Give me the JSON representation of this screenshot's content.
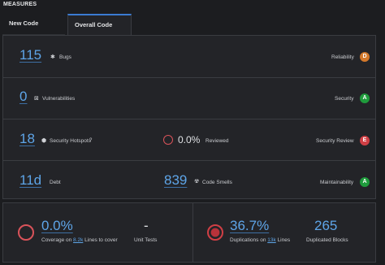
{
  "header": {
    "title": "MEASURES"
  },
  "tabs": [
    {
      "label": "New Code"
    },
    {
      "label": "Overall Code"
    }
  ],
  "rows": {
    "reliability": {
      "value": "115",
      "metric": "Bugs",
      "category": "Reliability",
      "rating": "D"
    },
    "security": {
      "value": "0",
      "metric": "Vulnerabilities",
      "category": "Security",
      "rating": "A"
    },
    "hotspots": {
      "value": "18",
      "metric": "Security Hotspots",
      "reviewed_value": "0.0%",
      "reviewed_label": "Reviewed",
      "category": "Security Review",
      "rating": "E"
    },
    "maintainability": {
      "debt_value": "11d",
      "debt_label": "Debt",
      "smells_value": "839",
      "smells_label": "Code Smells",
      "category": "Maintainability",
      "rating": "A"
    }
  },
  "coverage": {
    "value": "0.0%",
    "prefix": "Coverage on",
    "lines_value": "8.2k",
    "suffix": "Lines to cover",
    "unit_tests_value": "-",
    "unit_tests_label": "Unit Tests"
  },
  "duplications": {
    "value": "36.7%",
    "prefix": "Duplications on",
    "lines_value": "13k",
    "suffix": "Lines",
    "blocks_value": "265",
    "blocks_label": "Duplicated Blocks"
  },
  "colors": {
    "accent_blue": "#5ea5e8",
    "rating_a": "#1f9b3c",
    "rating_d": "#d3782a",
    "rating_e": "#d03f45",
    "coverage_ring": "#d9535a",
    "duplication_ring": "#d03f45"
  }
}
